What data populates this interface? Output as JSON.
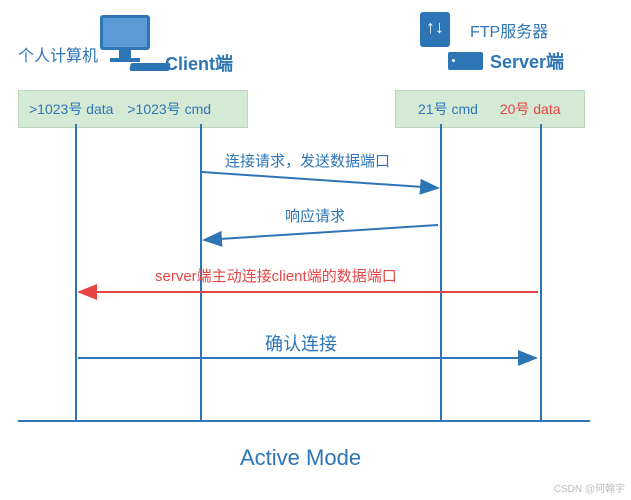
{
  "labels": {
    "pc_cn": "个人计算机",
    "client": "Client端",
    "ftp_cn": "FTP服务器",
    "server": "Server端"
  },
  "ports": {
    "left_data": ">1023号 data",
    "left_cmd": ">1023号 cmd",
    "right_cmd": "21号 cmd",
    "right_data": "20号 data"
  },
  "messages": {
    "m1": "连接请求，发送数据端口",
    "m2": "响应请求",
    "m3": "server端主动连接client端的数据端口",
    "m4": "确认连接"
  },
  "caption": "Active Mode",
  "watermark": "CSDN @何翰宇",
  "chart_data": {
    "type": "sequence-diagram",
    "title": "Active Mode",
    "participants": [
      {
        "name": "个人计算机 Client端",
        "lifelines": [
          ">1023号 data",
          ">1023号 cmd"
        ]
      },
      {
        "name": "FTP服务器 Server端",
        "lifelines": [
          "21号 cmd",
          "20号 data"
        ]
      }
    ],
    "messages": [
      {
        "from": ">1023号 cmd",
        "to": "21号 cmd",
        "text": "连接请求，发送数据端口",
        "color": "#2e75b6"
      },
      {
        "from": "21号 cmd",
        "to": ">1023号 cmd",
        "text": "响应请求",
        "color": "#2e75b6"
      },
      {
        "from": "20号 data",
        "to": ">1023号 data",
        "text": "server端主动连接client端的数据端口",
        "color": "#e64545"
      },
      {
        "from": ">1023号 data",
        "to": "20号 data",
        "text": "确认连接",
        "color": "#2e75b6"
      }
    ]
  }
}
